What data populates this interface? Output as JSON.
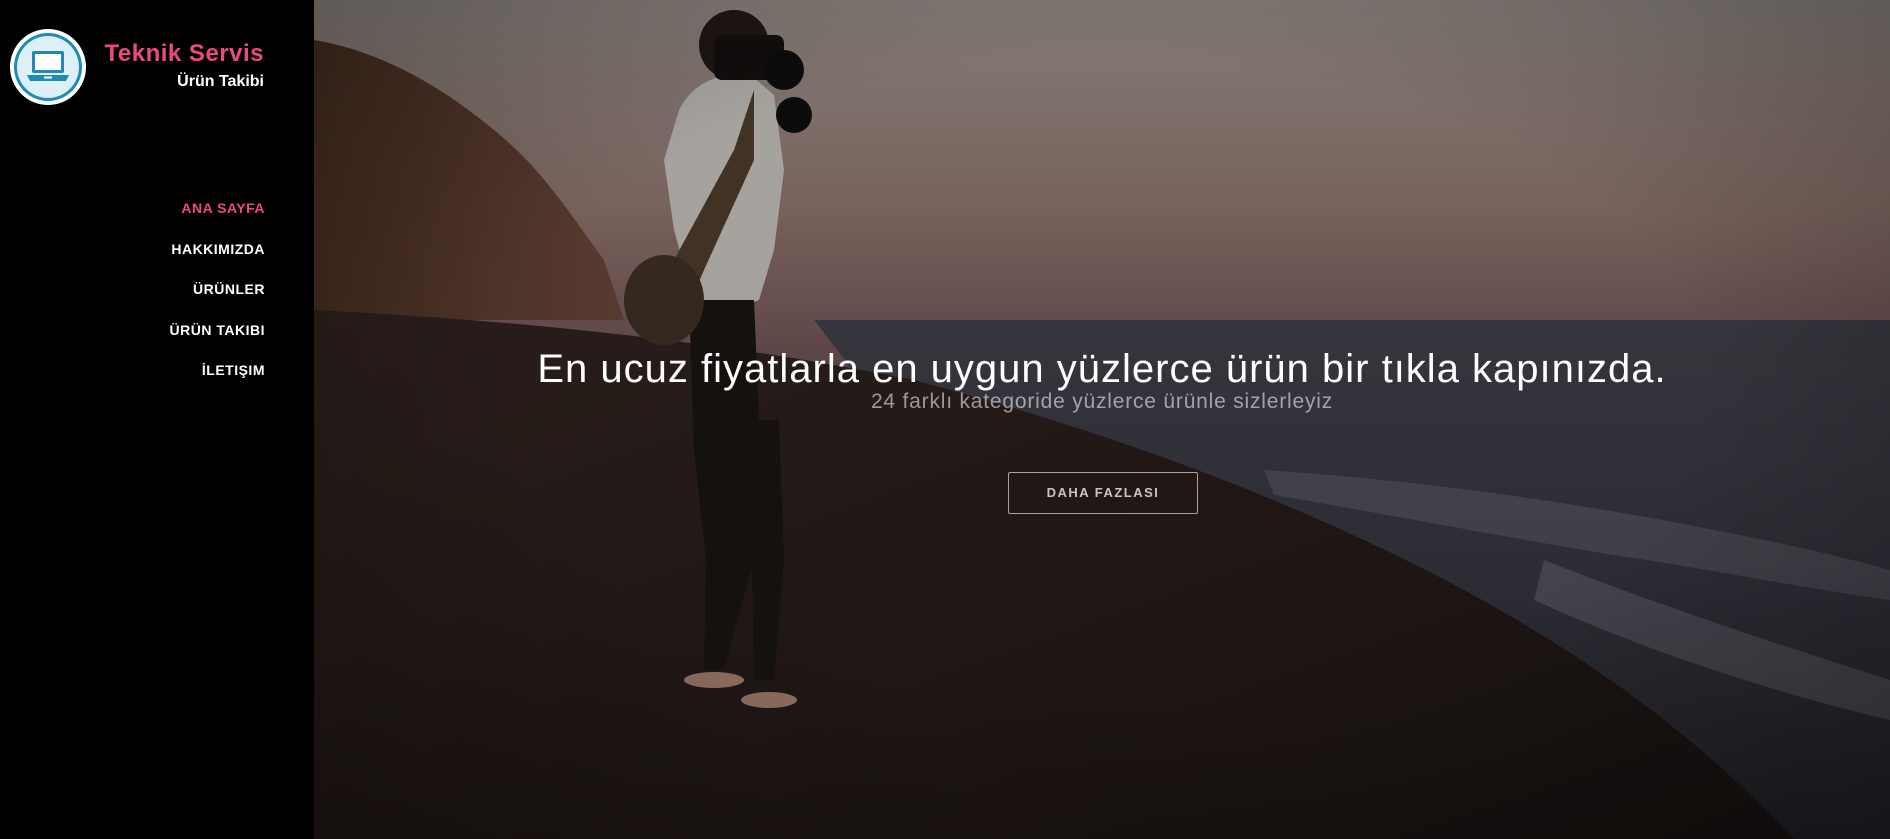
{
  "brand": {
    "title": "Teknik Servis",
    "subtitle": "Ürün Takibi",
    "logo_icon": "laptop-icon",
    "accent_color": "#ec4a7e"
  },
  "nav": {
    "items": [
      {
        "label": "ANA SAYFA",
        "active": true
      },
      {
        "label": "HAKKIMIZDA",
        "active": false
      },
      {
        "label": "ÜRÜNLER",
        "active": false
      },
      {
        "label": "ÜRÜN TAKIBI",
        "active": false
      },
      {
        "label": "İLETIŞIM",
        "active": false
      }
    ]
  },
  "hero": {
    "title": "En ucuz fiyatlarla en uygun yüzlerce ürün bir tıkla kapınızda.",
    "subtitle": "24 farklı kategoride yüzlerce ürünle sizlerleyiz",
    "button_label": "DAHA FAZLASI"
  }
}
